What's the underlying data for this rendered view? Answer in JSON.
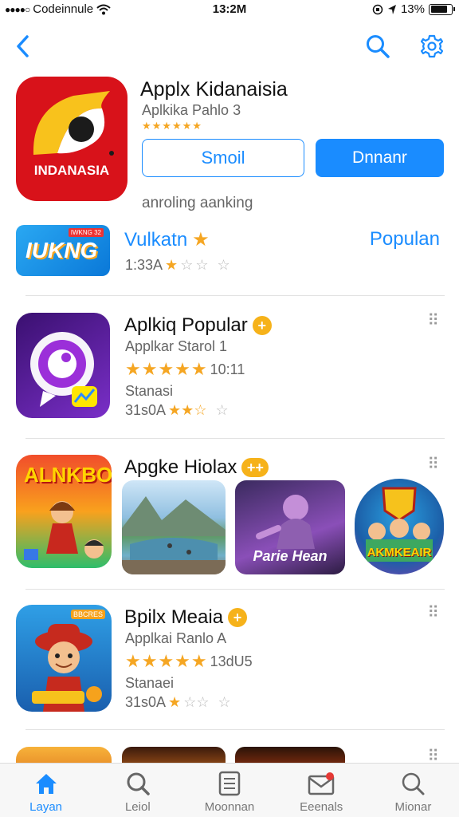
{
  "status": {
    "carrier": "Codeinnule",
    "time": "13:2M",
    "battery": "13%"
  },
  "hero": {
    "icon_caption": "INDANASIA",
    "title": "Applx Kidanaisia",
    "subtitle": "Aplkika Pahlo 3",
    "stars": "★★★★★★",
    "button_outline": "Smoil",
    "button_fill": "Dnnanr",
    "note": "anroling aanking"
  },
  "featured": {
    "icon_text": "IUKNG",
    "icon_tag": "IWKNG 32",
    "title": "Vulkatn",
    "star": "★",
    "link": "Populan",
    "rating": "1:33A"
  },
  "apps": [
    {
      "title": "Aplkiq Popular",
      "subtitle": "Applkar Starol 1",
      "count": "10:11",
      "extra": "Stanasi",
      "rating": "31s0A"
    },
    {
      "title": "Apgke Hiolax",
      "icon_text": "ALNKBO",
      "shot2_text": "Parie Hean",
      "shot3_text": "AKMKEAIR"
    },
    {
      "title": "Bpilx Meaia",
      "subtitle": "Applkai Ranlo A",
      "count": "13dU5",
      "extra": "Stanaei",
      "rating": "31s0A",
      "icon_tag": "BBCRES"
    }
  ],
  "tabs": [
    {
      "label": "Layan",
      "icon": "home-icon"
    },
    {
      "label": "Leiol",
      "icon": "search-icon"
    },
    {
      "label": "Moonnan",
      "icon": "list-icon"
    },
    {
      "label": "Eeenals",
      "icon": "mail-icon"
    },
    {
      "label": "Mionar",
      "icon": "search-icon"
    }
  ],
  "colors": {
    "accent": "#1a8cff",
    "star": "#f5a623",
    "hero_red": "#d8121a",
    "purple": "#5b1f9e"
  }
}
